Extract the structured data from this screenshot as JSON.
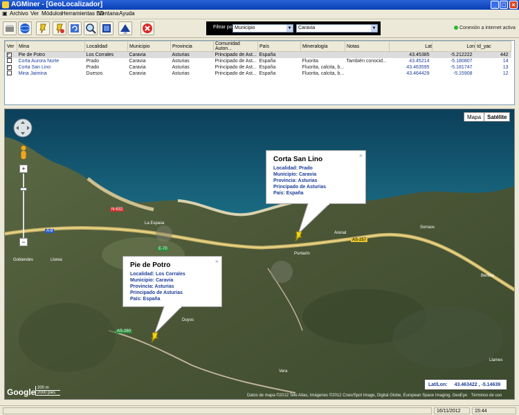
{
  "window": {
    "title": "AGMiner - [GeoLocalizador]"
  },
  "menu": [
    "Archivo",
    "Ver",
    "Módulos",
    "Herramientas BD",
    "Ventana",
    "Ayuda"
  ],
  "filter": {
    "label": "Filtrar por:",
    "field": "Municipio",
    "value": "Caravia"
  },
  "connection": "Conexión a internet activa",
  "table": {
    "columns": [
      "Ver",
      "Mina",
      "Localidad",
      "Municipio",
      "Provincia",
      "Comunidad Auton...",
      "País",
      "Mineralogía",
      "Notas",
      "Lat",
      "Lon",
      "Id_yac"
    ],
    "rows": [
      {
        "checked": true,
        "mina": "Pie de Potro",
        "localidad": "Los Corrales",
        "municipio": "Caravia",
        "provincia": "Asturias",
        "comunidad": "Principado de Ast...",
        "pais": "España",
        "mineralogia": "",
        "notas": "",
        "lat": "43.45385",
        "lon": "-5.212222",
        "id": "442",
        "selected": true
      },
      {
        "checked": false,
        "mina": "Corta Aurora Norte",
        "localidad": "Prado",
        "municipio": "Caravia",
        "provincia": "Asturias",
        "comunidad": "Principado de Ast...",
        "pais": "España",
        "mineralogia": "Fluorita",
        "notas": "También conocid...",
        "lat": "43.45214",
        "lon": "-5.180807",
        "id": "14",
        "selected": false
      },
      {
        "checked": true,
        "mina": "Corta San Lino",
        "localidad": "Prado",
        "municipio": "Caravia",
        "provincia": "Asturias",
        "comunidad": "Principado de Ast...",
        "pais": "España",
        "mineralogia": "Fluorita, calcita, b...",
        "notas": "",
        "lat": "43.463595",
        "lon": "-5.181747",
        "id": "13",
        "selected": false
      },
      {
        "checked": false,
        "mina": "Mina Jaimina",
        "localidad": "Duesos",
        "municipio": "Caravia",
        "provincia": "Asturias",
        "comunidad": "Principado de Ast...",
        "pais": "España",
        "mineralogia": "Fluorita, calcita, b...",
        "notas": "",
        "lat": "43.464429",
        "lon": "-5.15908",
        "id": "12",
        "selected": false
      }
    ]
  },
  "map": {
    "type_buttons": [
      "Mapa",
      "Satélite"
    ],
    "info_lino": {
      "title": "Corta San Lino",
      "lines": [
        "Localidad: Prado",
        "Municipio: Caravia",
        "Provincia: Asturias",
        "Principado de Asturias",
        "País: España"
      ]
    },
    "info_potro": {
      "title": "Pie de Potro",
      "lines": [
        "Localidad: Los Corrales",
        "Municipio: Caravia",
        "Provincia: Asturias",
        "Principado de Asturias",
        "País: España"
      ]
    },
    "latlon": {
      "label": "Lat/Lon:",
      "value": "43.463422 , -5.14639"
    },
    "credits": "Datos de mapa ©2012 Tele Atlas, Imágenes ©2012 Cnes/Spot Image, Digital Globe, European Space Imaging, GeoEye · Términos de uso",
    "logo": "Google",
    "scale": [
      "200 m",
      "2000 pies"
    ],
    "places": [
      "La Espasa",
      "Llorea",
      "Gobiendes",
      "Duyos",
      "Puntarín",
      "Arenal",
      "Berbes",
      "Sorraos",
      "Llames",
      "Vera"
    ],
    "roads": [
      "N-632",
      "A-8",
      "E-70",
      "AS-260",
      "AS-257"
    ]
  },
  "status": {
    "date": "16/11/2012",
    "time": "15:44"
  },
  "colors": {
    "titlebar": "#0a3fb5",
    "link": "#1b3c99",
    "sea": "#0f4d6b",
    "land": "#4d5a3a"
  }
}
